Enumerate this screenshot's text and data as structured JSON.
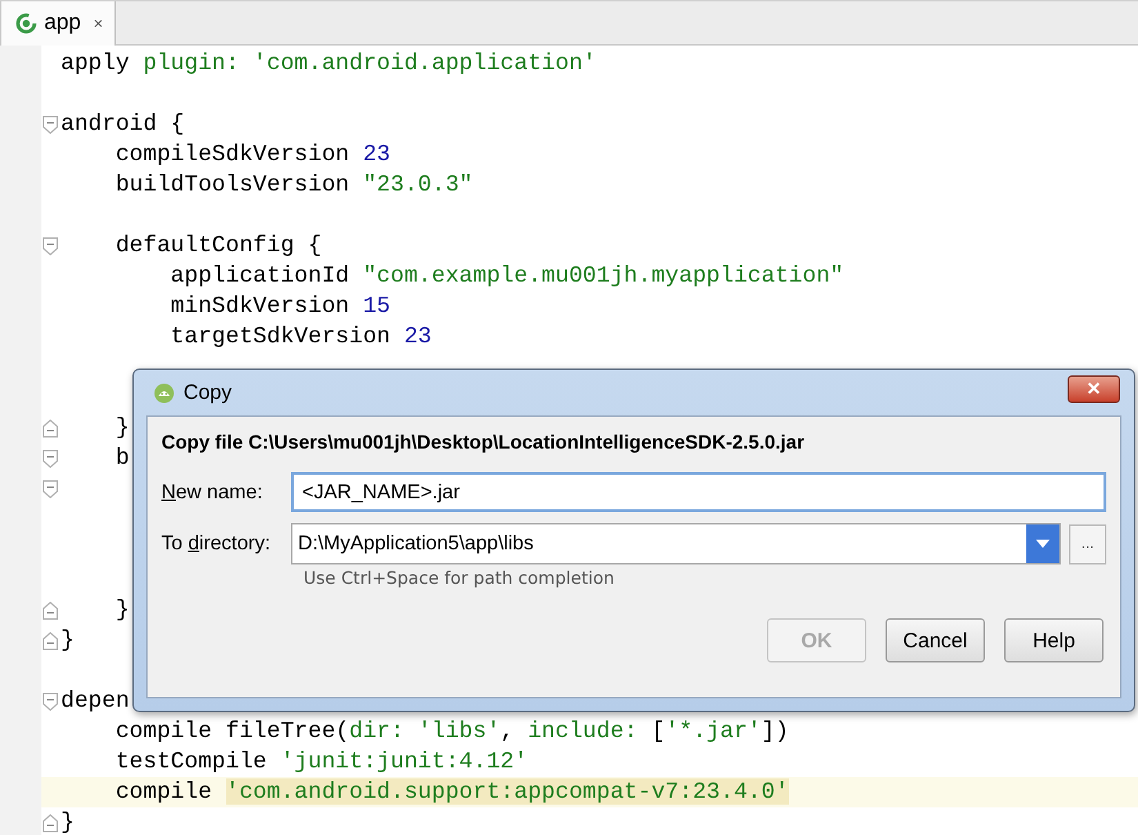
{
  "tabs": [
    {
      "label": "app",
      "close": "×",
      "selected": true
    }
  ],
  "editor": {
    "lines": [
      {
        "kind": "code",
        "tokens": [
          {
            "text": "apply ",
            "kind": "plain"
          },
          {
            "text": "plugin: ",
            "kind": "named"
          },
          {
            "text": "'com.android.application'",
            "kind": "string"
          }
        ]
      },
      {
        "kind": "blank"
      },
      {
        "kind": "code",
        "fold_start": true,
        "tokens": [
          {
            "text": "android {",
            "kind": "plain"
          }
        ]
      },
      {
        "kind": "code",
        "tokens": [
          {
            "text": "    compileSdkVersion ",
            "kind": "plain"
          },
          {
            "text": "23",
            "kind": "number"
          }
        ]
      },
      {
        "kind": "code",
        "tokens": [
          {
            "text": "    buildToolsVersion ",
            "kind": "plain"
          },
          {
            "text": "\"23.0.3\"",
            "kind": "string"
          }
        ]
      },
      {
        "kind": "blank"
      },
      {
        "kind": "code",
        "fold_start": true,
        "tokens": [
          {
            "text": "    defaultConfig {",
            "kind": "plain"
          }
        ]
      },
      {
        "kind": "code",
        "tokens": [
          {
            "text": "        applicationId ",
            "kind": "plain"
          },
          {
            "text": "\"com.example.mu001jh.myapplication\"",
            "kind": "string"
          }
        ]
      },
      {
        "kind": "code",
        "tokens": [
          {
            "text": "        minSdkVersion ",
            "kind": "plain"
          },
          {
            "text": "15",
            "kind": "number"
          }
        ]
      },
      {
        "kind": "code",
        "tokens": [
          {
            "text": "        targetSdkVersion ",
            "kind": "plain"
          },
          {
            "text": "23",
            "kind": "number"
          }
        ]
      },
      {
        "kind": "blank"
      },
      {
        "kind": "blank"
      },
      {
        "kind": "code",
        "fold_end": true,
        "tokens": [
          {
            "text": "    }",
            "kind": "plain"
          }
        ]
      },
      {
        "kind": "code",
        "fold_start": true,
        "tokens": [
          {
            "text": "    b",
            "kind": "plain"
          }
        ]
      },
      {
        "kind": "blank",
        "fold_start": true
      },
      {
        "kind": "blank"
      },
      {
        "kind": "blank"
      },
      {
        "kind": "blank"
      },
      {
        "kind": "code",
        "fold_end": true,
        "tokens": [
          {
            "text": "    }",
            "kind": "plain"
          }
        ]
      },
      {
        "kind": "code",
        "fold_end": true,
        "tokens": [
          {
            "text": "}",
            "kind": "plain"
          }
        ]
      },
      {
        "kind": "blank"
      },
      {
        "kind": "code",
        "fold_start": true,
        "tokens": [
          {
            "text": "depen",
            "kind": "plain"
          }
        ]
      },
      {
        "kind": "code",
        "tokens": [
          {
            "text": "    compile fileTree(",
            "kind": "plain"
          },
          {
            "text": "dir: ",
            "kind": "named"
          },
          {
            "text": "'libs'",
            "kind": "string"
          },
          {
            "text": ", ",
            "kind": "plain"
          },
          {
            "text": "include: ",
            "kind": "named"
          },
          {
            "text": "[",
            "kind": "plain"
          },
          {
            "text": "'*.jar'",
            "kind": "string"
          },
          {
            "text": "])",
            "kind": "plain"
          }
        ]
      },
      {
        "kind": "code",
        "tokens": [
          {
            "text": "    testCompile ",
            "kind": "plain"
          },
          {
            "text": "'junit:junit:4.12'",
            "kind": "string"
          }
        ]
      },
      {
        "kind": "code",
        "current": true,
        "tokens": [
          {
            "text": "    compile ",
            "kind": "plain"
          },
          {
            "text": "'com.android.support:appcompat-v7:23.4.0'",
            "kind": "string",
            "highlighted": true
          }
        ]
      },
      {
        "kind": "code",
        "fold_end": true,
        "tokens": [
          {
            "text": "}",
            "kind": "plain"
          }
        ]
      }
    ]
  },
  "dialog": {
    "title": "Copy",
    "close": "✕",
    "heading": "Copy file C:\\Users\\mu001jh\\Desktop\\LocationIntelligenceSDK-2.5.0.jar",
    "fields": [
      {
        "kind": "text",
        "label": {
          "key": "N",
          "post": "ew name:"
        },
        "value": "<JAR_NAME>.jar",
        "focused": true
      },
      {
        "kind": "combo",
        "label": {
          "pre": "To ",
          "key": "d",
          "post": "irectory:"
        },
        "value": "D:\\MyApplication5\\app\\libs",
        "browse": "...",
        "hint": "Use Ctrl+Space for path completion"
      }
    ],
    "buttons": [
      {
        "label": "OK",
        "disabled": true
      },
      {
        "label": "Cancel",
        "disabled": false
      },
      {
        "label": "Help",
        "disabled": false
      }
    ]
  }
}
